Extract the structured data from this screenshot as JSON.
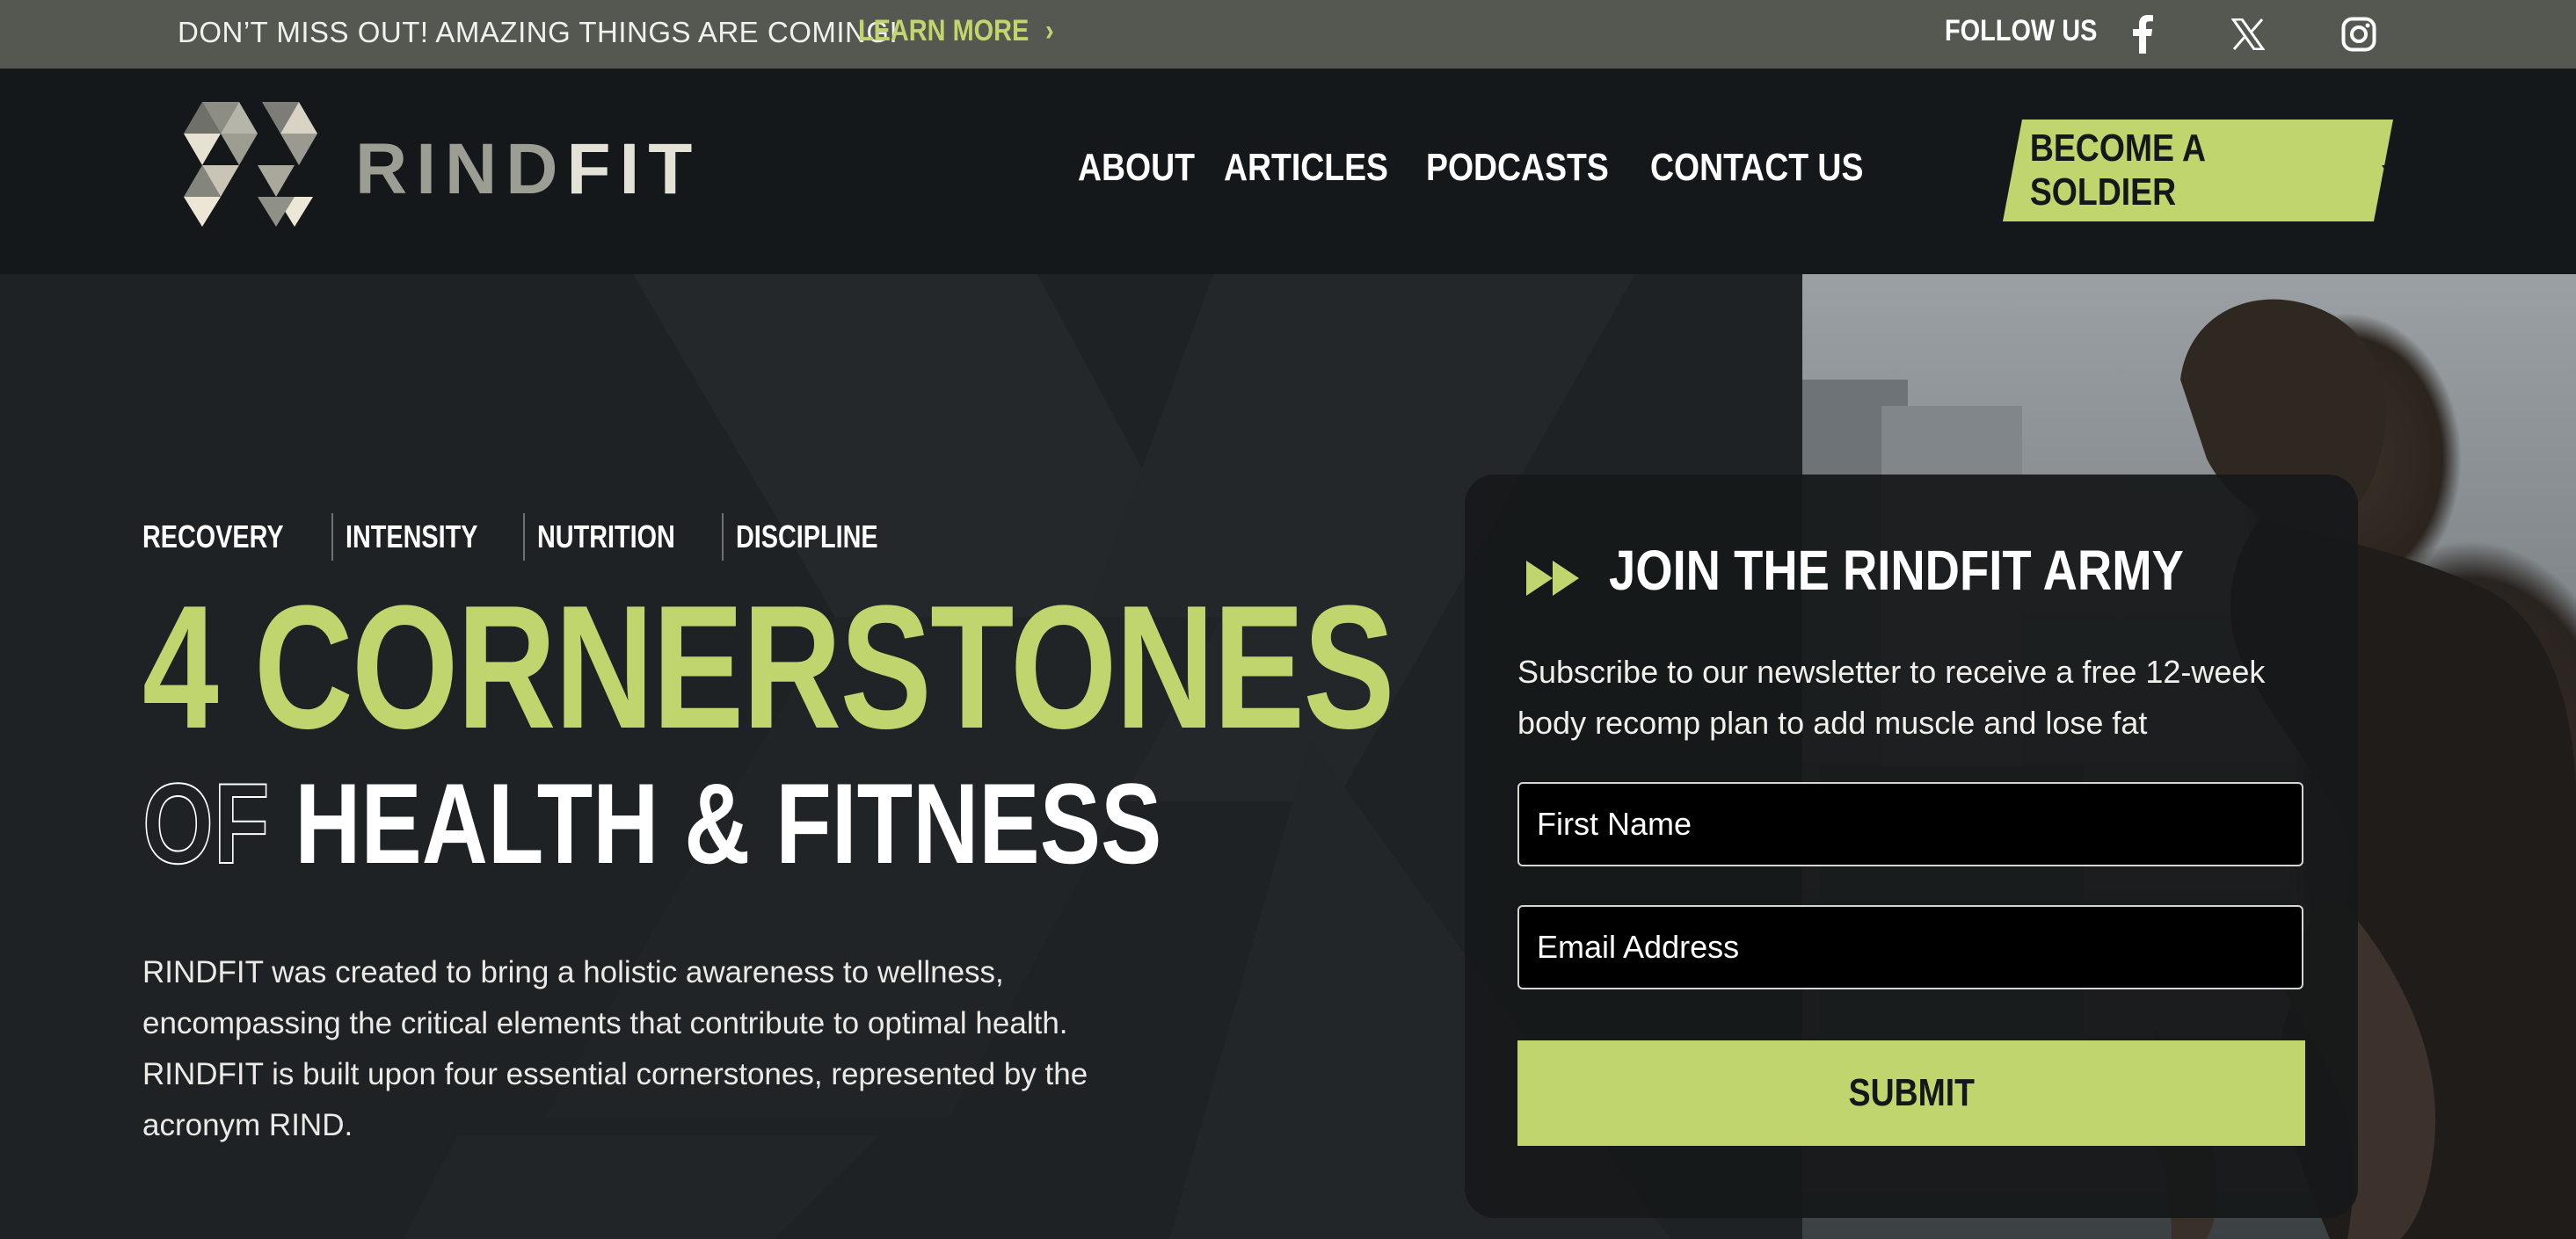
{
  "topbar": {
    "promo": "DON’T MISS OUT! AMAZING THINGS ARE COMING!",
    "learn_more": "LEARN MORE",
    "follow_us": "FOLLOW US",
    "social": [
      "facebook-icon",
      "x-icon",
      "instagram-icon"
    ]
  },
  "header": {
    "logo_part1": "RIND",
    "logo_part2": "FIT",
    "nav": [
      "ABOUT",
      "ARTICLES",
      "PODCASTS",
      "CONTACT US"
    ],
    "cta": "BECOME A SOLDIER"
  },
  "hero": {
    "pillars": [
      "RECOVERY",
      "INTENSITY",
      "NUTRITION",
      "DISCIPLINE"
    ],
    "headline_1": "4 CORNERSTONES",
    "headline_of": "OF",
    "headline_2": "HEALTH & FITNESS",
    "description": "RINDFIT was created to bring a holistic awareness to wellness, encompassing the critical elements that contribute to optimal health. RINDFIT is built upon four essential cornerstones, represented by the acronym RIND."
  },
  "signup": {
    "title": "JOIN THE RINDFIT ARMY",
    "description": "Subscribe to our newsletter to receive a free 12-week body recomp plan to add muscle and lose fat",
    "first_name_placeholder": "First Name",
    "email_placeholder": "Email Address",
    "submit": "SUBMIT"
  },
  "colors": {
    "accent": "#c0d56d",
    "topbar": "#545851",
    "background": "#15181a"
  }
}
